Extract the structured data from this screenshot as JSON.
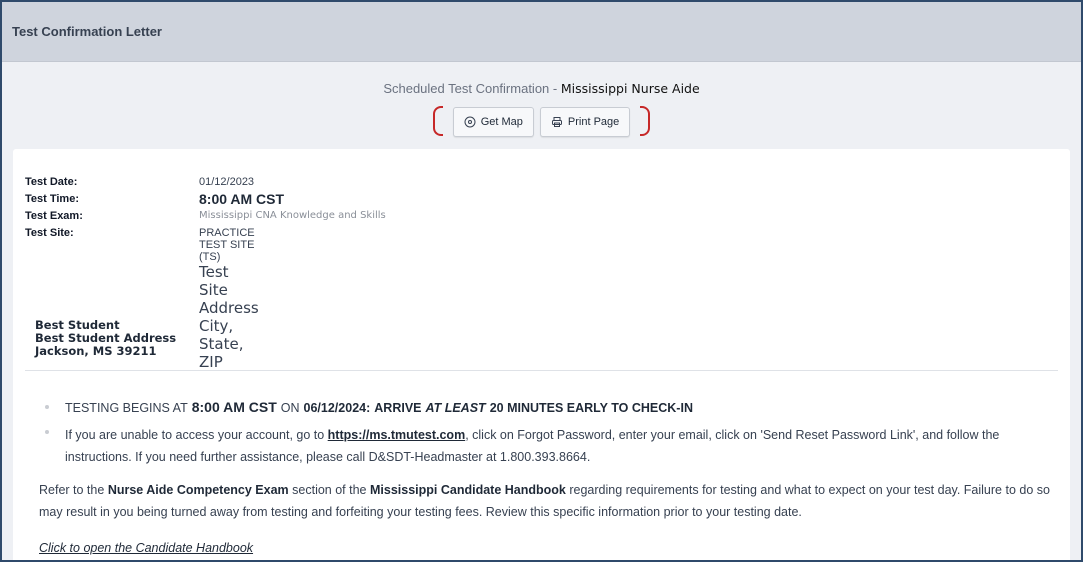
{
  "window": {
    "title": "Test Confirmation Letter"
  },
  "header": {
    "lead": "Scheduled Test Confirmation -",
    "state": "Mississippi Nurse Aide",
    "buttons": {
      "map": "Get Map",
      "print": "Print Page"
    }
  },
  "details": {
    "date_label": "Test Date:",
    "date": "01/12/2023",
    "time_label": "Test Time:",
    "time": "8:00 AM CST",
    "exam_label": "Test Exam:",
    "exam": "Mississippi CNA Knowledge and Skills",
    "site_label": "Test Site:",
    "site": "PRACTICE TEST SITE (TS)",
    "site_address1": "Test Site Address",
    "site_address2": "City, State, ZIP"
  },
  "student": {
    "name": "Best Student",
    "address": "Best Student Address",
    "city": "Jackson, MS 39211"
  },
  "notice": {
    "b1_pre": "TESTING BEGINS AT",
    "b1_time": "8:00 AM CST",
    "b1_on": "ON",
    "b1_date": "06/12/2024:",
    "b1_arrive": "ARRIVE",
    "b1_least": "AT LEAST",
    "b1_post": "20 MINUTES EARLY TO CHECK-IN",
    "b2_pre": "If you are unable to access your account, go to",
    "b2_link": "https://ms.tmutest.com",
    "b2_post": ", click on Forgot Password, enter your email, click on 'Send Reset Password Link', and follow the instructions.  If you need further assistance, please call D&SDT-Headmaster at 1.800.393.8664.",
    "p_pre": "Refer to the",
    "p_b1": "Nurse Aide Competency Exam",
    "p_mid": "section of the",
    "p_b2": "Mississippi Candidate Handbook",
    "p_post": "regarding requirements for testing and what to expect on your test day. Failure to do so may result in you being turned away from testing and forfeiting your testing fees.  Review this specific information prior to your testing date.",
    "handbook_link": "Click to open the Candidate Handbook"
  },
  "icons": {
    "map": "location-pin-icon",
    "print": "printer-icon"
  },
  "colors": {
    "frame": "#2f4a6b",
    "titlebar": "#cfd4dd",
    "highlight": "#c62828"
  }
}
